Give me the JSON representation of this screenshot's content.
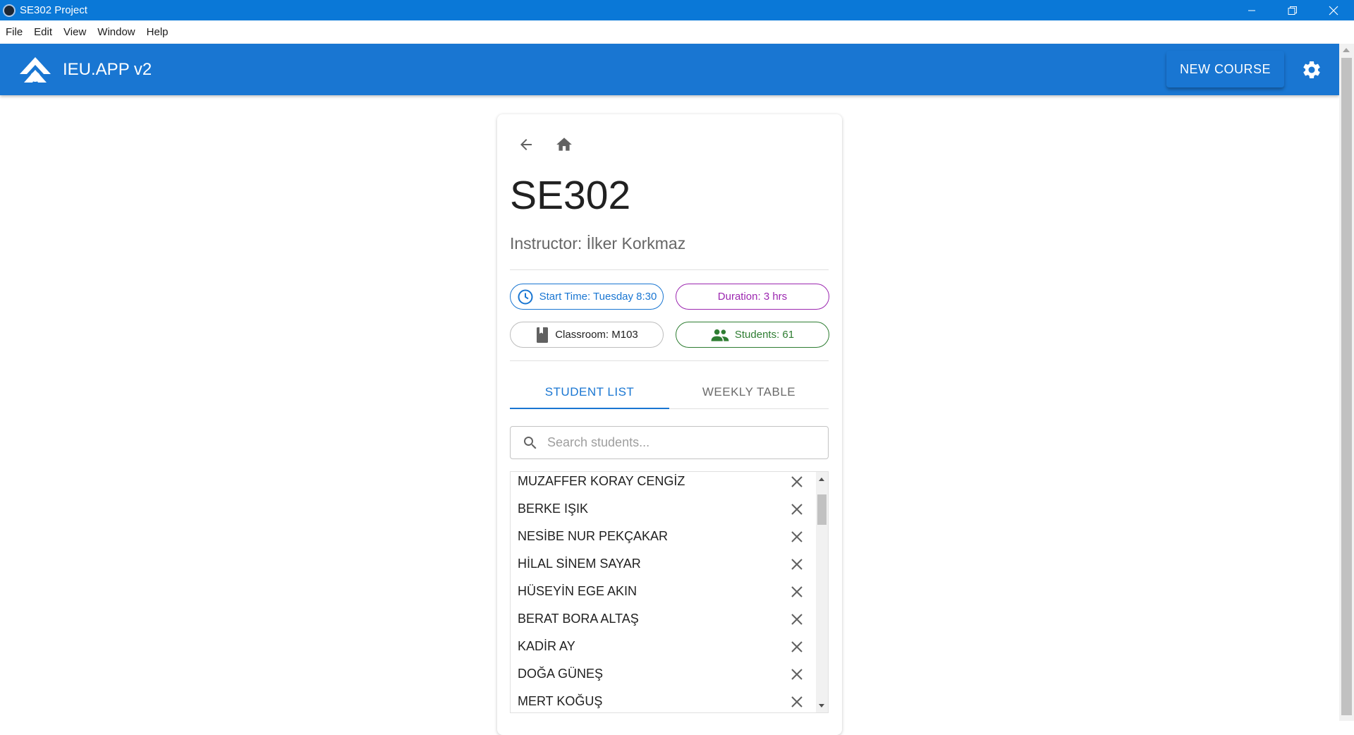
{
  "window": {
    "title": "SE302 Project"
  },
  "menu": [
    "File",
    "Edit",
    "View",
    "Window",
    "Help"
  ],
  "appbar": {
    "name": "IEU.APP v2",
    "new_course_label": "NEW COURSE"
  },
  "course": {
    "code": "SE302",
    "instructor": "Instructor: İlker Korkmaz",
    "chips": {
      "start_time": "Start Time: Tuesday 8:30",
      "duration": "Duration: 3 hrs",
      "classroom": "Classroom: M103",
      "students": "Students: 61"
    }
  },
  "tabs": [
    {
      "label": "STUDENT LIST",
      "active": true
    },
    {
      "label": "WEEKLY TABLE",
      "active": false
    }
  ],
  "search": {
    "placeholder": "Search students...",
    "value": ""
  },
  "students": [
    "MUZAFFER KORAY CENGİZ",
    "BERKE IŞIK",
    "NESİBE NUR PEKÇAKAR",
    "HİLAL SİNEM SAYAR",
    "HÜSEYİN EGE AKIN",
    "BERAT BORA ALTAŞ",
    "KADİR AY",
    "DOĞA GÜNEŞ",
    "MERT KOĞUŞ"
  ],
  "colors": {
    "primary": "#1976d2",
    "titlebar": "#0a78d7",
    "duration": "#9c27b0",
    "students": "#2e7d32"
  }
}
